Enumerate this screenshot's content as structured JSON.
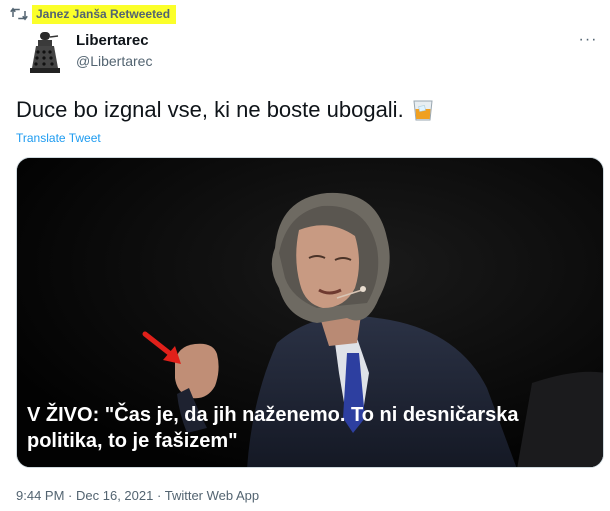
{
  "retweet": {
    "label": "Janez Janša Retweeted",
    "highlight_color": "#fbff2a"
  },
  "author": {
    "name": "Libertarec",
    "handle": "@Libertarec"
  },
  "more_label": "···",
  "tweet": {
    "text": "Duce bo izgnal vse, ki ne boste ubogali.",
    "emoji": "tumbler-glass-emoji",
    "translate_label": "Translate Tweet"
  },
  "media": {
    "caption": "V ŽIVO: \"Čas je, da jih naženemo. To ni desničarska politika, to je fašizem\"",
    "annotation": "red-arrow-icon"
  },
  "meta": {
    "time": "9:44 PM",
    "date": "Dec 16, 2021",
    "source": "Twitter Web App",
    "separator": "·"
  },
  "colors": {
    "link": "#1d9bf0",
    "muted": "#536471",
    "text": "#0f1419",
    "arrow": "#e0201a"
  }
}
